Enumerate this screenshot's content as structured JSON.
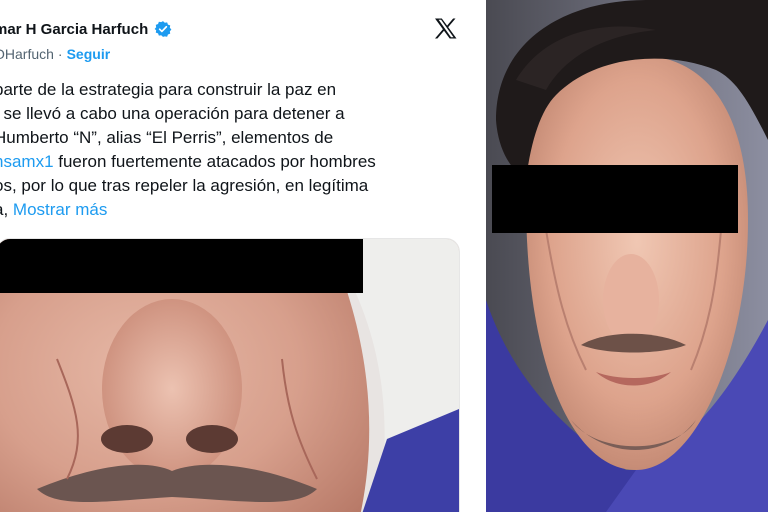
{
  "tweet": {
    "author_name": "mar H Garcia Harfuch",
    "handle": "OHarfuch",
    "separator": "·",
    "follow_label": "Seguir",
    "lines": [
      "parte de la estrategia para construir la paz en",
      ", se llevó a cabo una operación para detener a",
      "Humberto “N”, alias “El Perris”, elementos de"
    ],
    "line4_mention": "nsamx1",
    "line4_rest": " fueron fuertemente atacados por hombres",
    "line5": "os, por lo que tras repeler la agresión, en legítima",
    "line6_start": "a, ",
    "more_label": "Mostrar más"
  },
  "colors": {
    "accent": "#1d9bf0",
    "text": "#0f1419",
    "secondary": "#536471"
  },
  "icons": {
    "verified": "verified-badge-icon",
    "platform": "x-logo-icon"
  }
}
